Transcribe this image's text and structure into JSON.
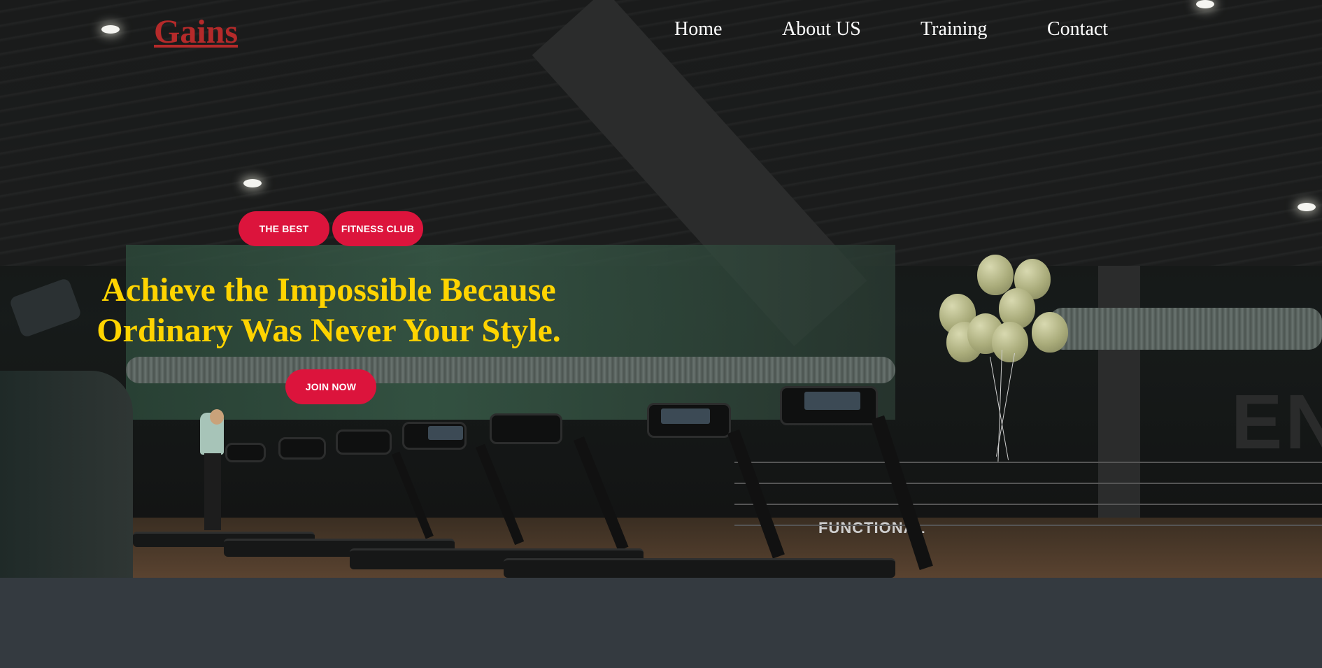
{
  "brand": {
    "name": "Gains",
    "color": "#b52a2a"
  },
  "nav": {
    "items": [
      {
        "label": "Home"
      },
      {
        "label": "About US"
      },
      {
        "label": "Training"
      },
      {
        "label": "Contact"
      }
    ]
  },
  "hero": {
    "badges": [
      "THE BEST",
      "FITNESS CLUB"
    ],
    "headline_line1": "Achieve the Impossible Because",
    "headline_line2": "Ordinary Was Never Your Style.",
    "cta_label": "JOIN NOW",
    "background_image": "gym-treadmills-photo",
    "wall_letters": "EN",
    "area_sign": "FUNCTIONAL",
    "colors": {
      "accent": "#dc143c",
      "headline": "#ffd400",
      "nav_text": "#ffffff",
      "footer_band": "#343a40"
    }
  }
}
